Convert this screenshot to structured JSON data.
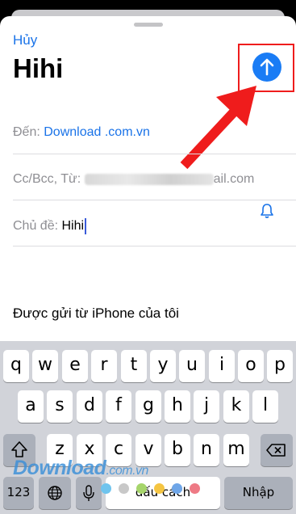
{
  "compose": {
    "cancel_label": "Hủy",
    "title": "Hihi",
    "to_label": "Đến:",
    "to_value": "Download .com.vn",
    "ccbcc_label": "Cc/Bcc, Từ:",
    "from_email_tail": "ail.com",
    "subject_label": "Chủ đề:",
    "subject_value": "Hihi",
    "signature": "Được gửi từ iPhone của tôi"
  },
  "keyboard": {
    "row1": [
      "q",
      "w",
      "e",
      "r",
      "t",
      "y",
      "u",
      "i",
      "o",
      "p"
    ],
    "row2": [
      "a",
      "s",
      "d",
      "f",
      "g",
      "h",
      "j",
      "k",
      "l"
    ],
    "row3": [
      "z",
      "x",
      "c",
      "v",
      "b",
      "n",
      "m"
    ],
    "numbers_label": "123",
    "space_label": "dấu cách",
    "return_label": "Nhập"
  },
  "watermark": {
    "brand": "Download",
    "suffix": ".com.vn"
  },
  "icons": {
    "send": "arrow-up-circle-icon",
    "bell": "bell-icon",
    "shift": "shift-icon",
    "backspace": "delete-icon",
    "globe": "globe-icon",
    "mic": "microphone-icon"
  },
  "colors": {
    "accent": "#1a73e8",
    "send_button": "#1a7cf5",
    "annotation_red": "#ef1c1c"
  }
}
